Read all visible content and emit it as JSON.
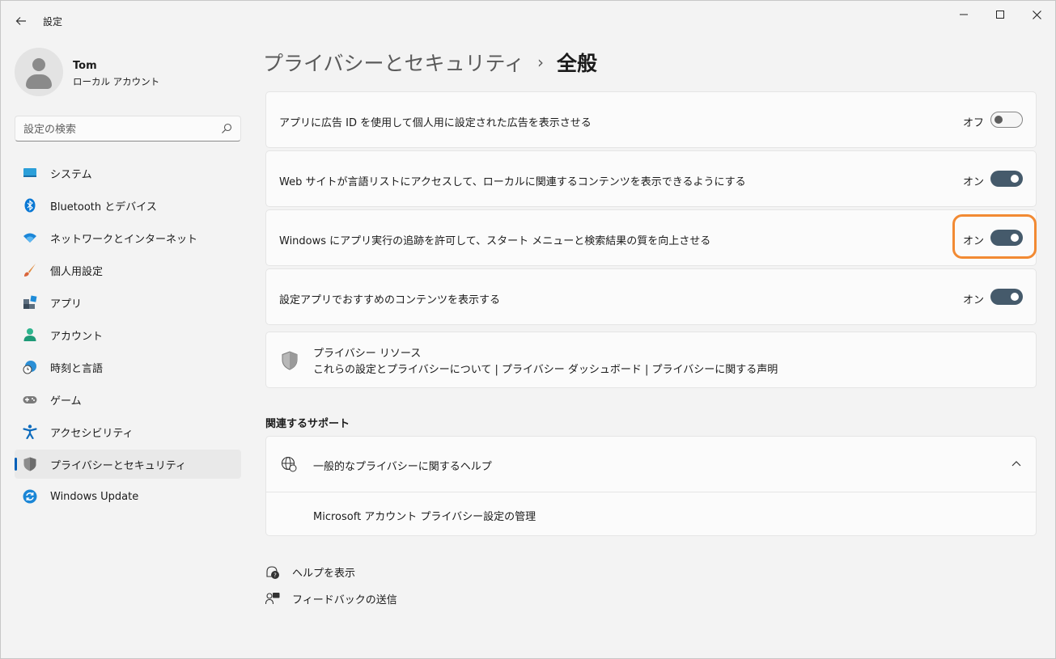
{
  "window": {
    "title": "設定"
  },
  "user": {
    "name": "Tom",
    "account_type": "ローカル アカウント"
  },
  "search": {
    "placeholder": "設定の検索"
  },
  "nav": [
    {
      "label": "システム",
      "icon": "system-icon"
    },
    {
      "label": "Bluetooth とデバイス",
      "icon": "bluetooth-icon"
    },
    {
      "label": "ネットワークとインターネット",
      "icon": "wifi-icon"
    },
    {
      "label": "個人用設定",
      "icon": "brush-icon"
    },
    {
      "label": "アプリ",
      "icon": "apps-icon"
    },
    {
      "label": "アカウント",
      "icon": "account-icon"
    },
    {
      "label": "時刻と言語",
      "icon": "globe-clock-icon"
    },
    {
      "label": "ゲーム",
      "icon": "gamepad-icon"
    },
    {
      "label": "アクセシビリティ",
      "icon": "accessibility-icon"
    },
    {
      "label": "プライバシーとセキュリティ",
      "icon": "shield-icon",
      "active": true
    },
    {
      "label": "Windows Update",
      "icon": "update-icon"
    }
  ],
  "breadcrumb": {
    "parent": "プライバシーとセキュリティ",
    "separator": "›",
    "current": "全般"
  },
  "settings": [
    {
      "label": "アプリに広告 ID を使用して個人用に設定された広告を表示させる",
      "state": "オフ",
      "on": false
    },
    {
      "label": "Web サイトが言語リストにアクセスして、ローカルに関連するコンテンツを表示できるようにする",
      "state": "オン",
      "on": true
    },
    {
      "label": "Windows にアプリ実行の追跡を許可して、スタート メニューと検索結果の質を向上させる",
      "state": "オン",
      "on": true
    },
    {
      "label": "設定アプリでおすすめのコンテンツを表示する",
      "state": "オン",
      "on": true
    }
  ],
  "privacy_resources": {
    "title": "プライバシー リソース",
    "links": "これらの設定とプライバシーについて | プライバシー ダッシュボード | プライバシーに関する声明"
  },
  "support": {
    "section_title": "関連するサポート",
    "expander_title": "一般的なプライバシーに関するヘルプ",
    "link": "Microsoft アカウント プライバシー設定の管理"
  },
  "footer": {
    "help": "ヘルプを表示",
    "feedback": "フィードバックの送信"
  },
  "colors": {
    "accent": "#005fb8",
    "toggle_on": "#455a6b",
    "highlight": "#f28a33"
  }
}
